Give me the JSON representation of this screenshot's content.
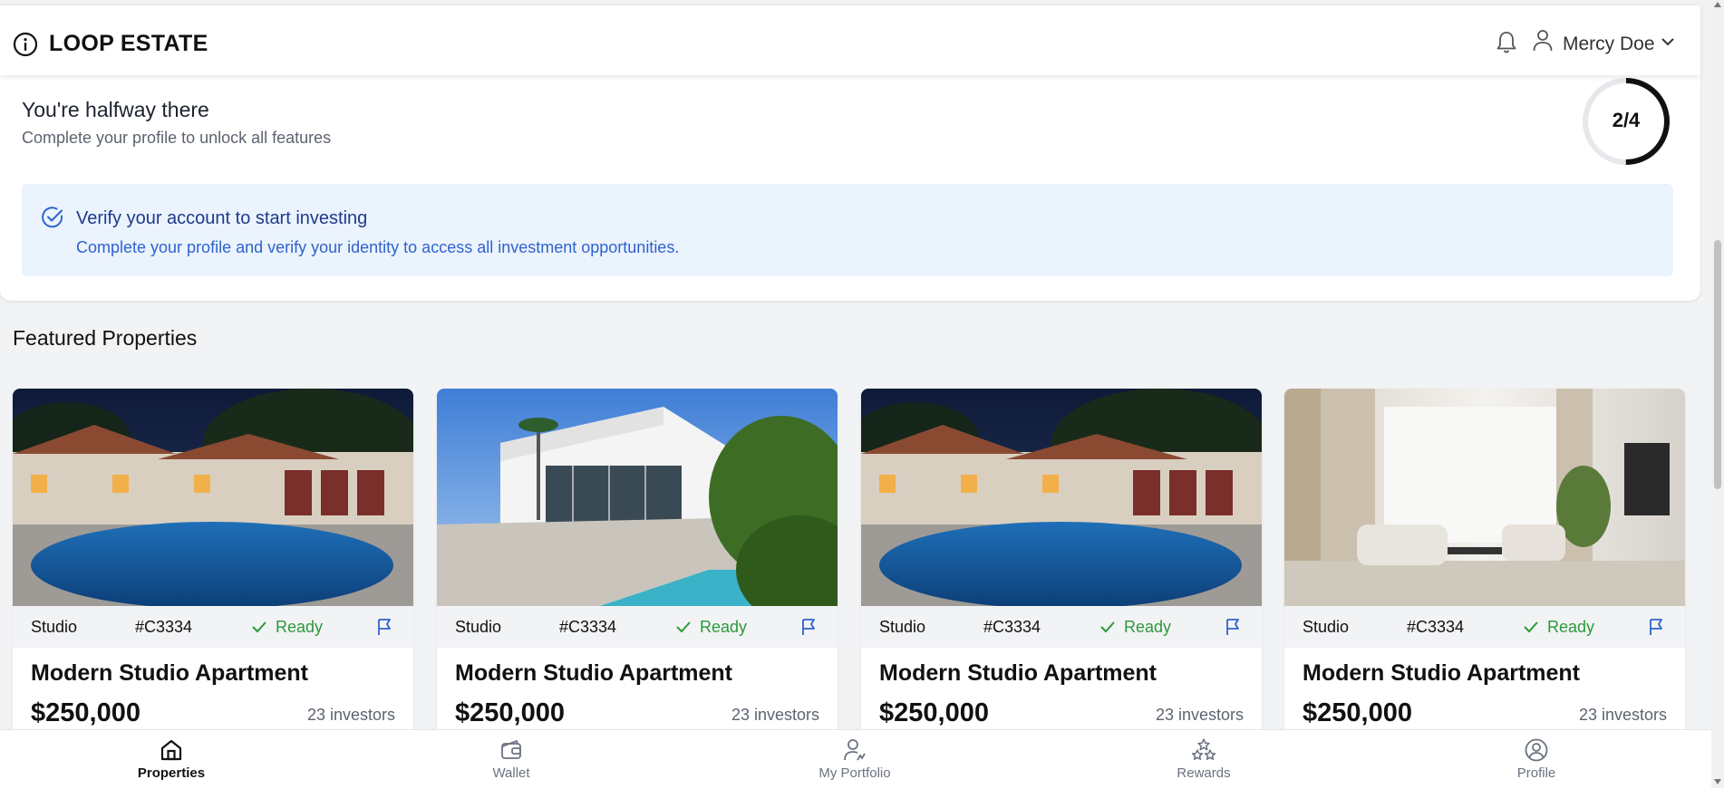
{
  "header": {
    "brand": "LOOP ESTATE",
    "user_name": "Mercy Doe"
  },
  "profile": {
    "title": "You're halfway there",
    "subtitle": "Complete your profile to unlock all features",
    "progress_text": "2/4",
    "progress_fraction": 0.5
  },
  "verify": {
    "title": "Verify your account to start investing",
    "subtitle": "Complete your profile and verify your identity to access all investment opportunities."
  },
  "section": {
    "title": "Featured Properties"
  },
  "cards": [
    {
      "type": "Studio",
      "id": "#C3334",
      "status": "Ready",
      "title": "Modern Studio Apartment",
      "price": "$250,000",
      "investors": "23 investors",
      "image": "villa-pool-night"
    },
    {
      "type": "Studio",
      "id": "#C3334",
      "status": "Ready",
      "title": "Modern Studio Apartment",
      "price": "$250,000",
      "investors": "23 investors",
      "image": "modern-house-pool"
    },
    {
      "type": "Studio",
      "id": "#C3334",
      "status": "Ready",
      "title": "Modern Studio Apartment",
      "price": "$250,000",
      "investors": "23 investors",
      "image": "villa-pool-night"
    },
    {
      "type": "Studio",
      "id": "#C3334",
      "status": "Ready",
      "title": "Modern Studio Apartment",
      "price": "$250,000",
      "investors": "23 investors",
      "image": "living-room"
    }
  ],
  "nav": [
    {
      "label": "Properties",
      "icon": "home-icon",
      "active": true
    },
    {
      "label": "Wallet",
      "icon": "wallet-icon",
      "active": false
    },
    {
      "label": "My Portfolio",
      "icon": "portfolio-icon",
      "active": false
    },
    {
      "label": "Rewards",
      "icon": "rewards-icon",
      "active": false
    },
    {
      "label": "Profile",
      "icon": "profile-icon",
      "active": false
    }
  ],
  "colors": {
    "accent_blue": "#2f63cc",
    "status_green": "#2a9a3a",
    "verify_bg": "#ebf3fd"
  }
}
